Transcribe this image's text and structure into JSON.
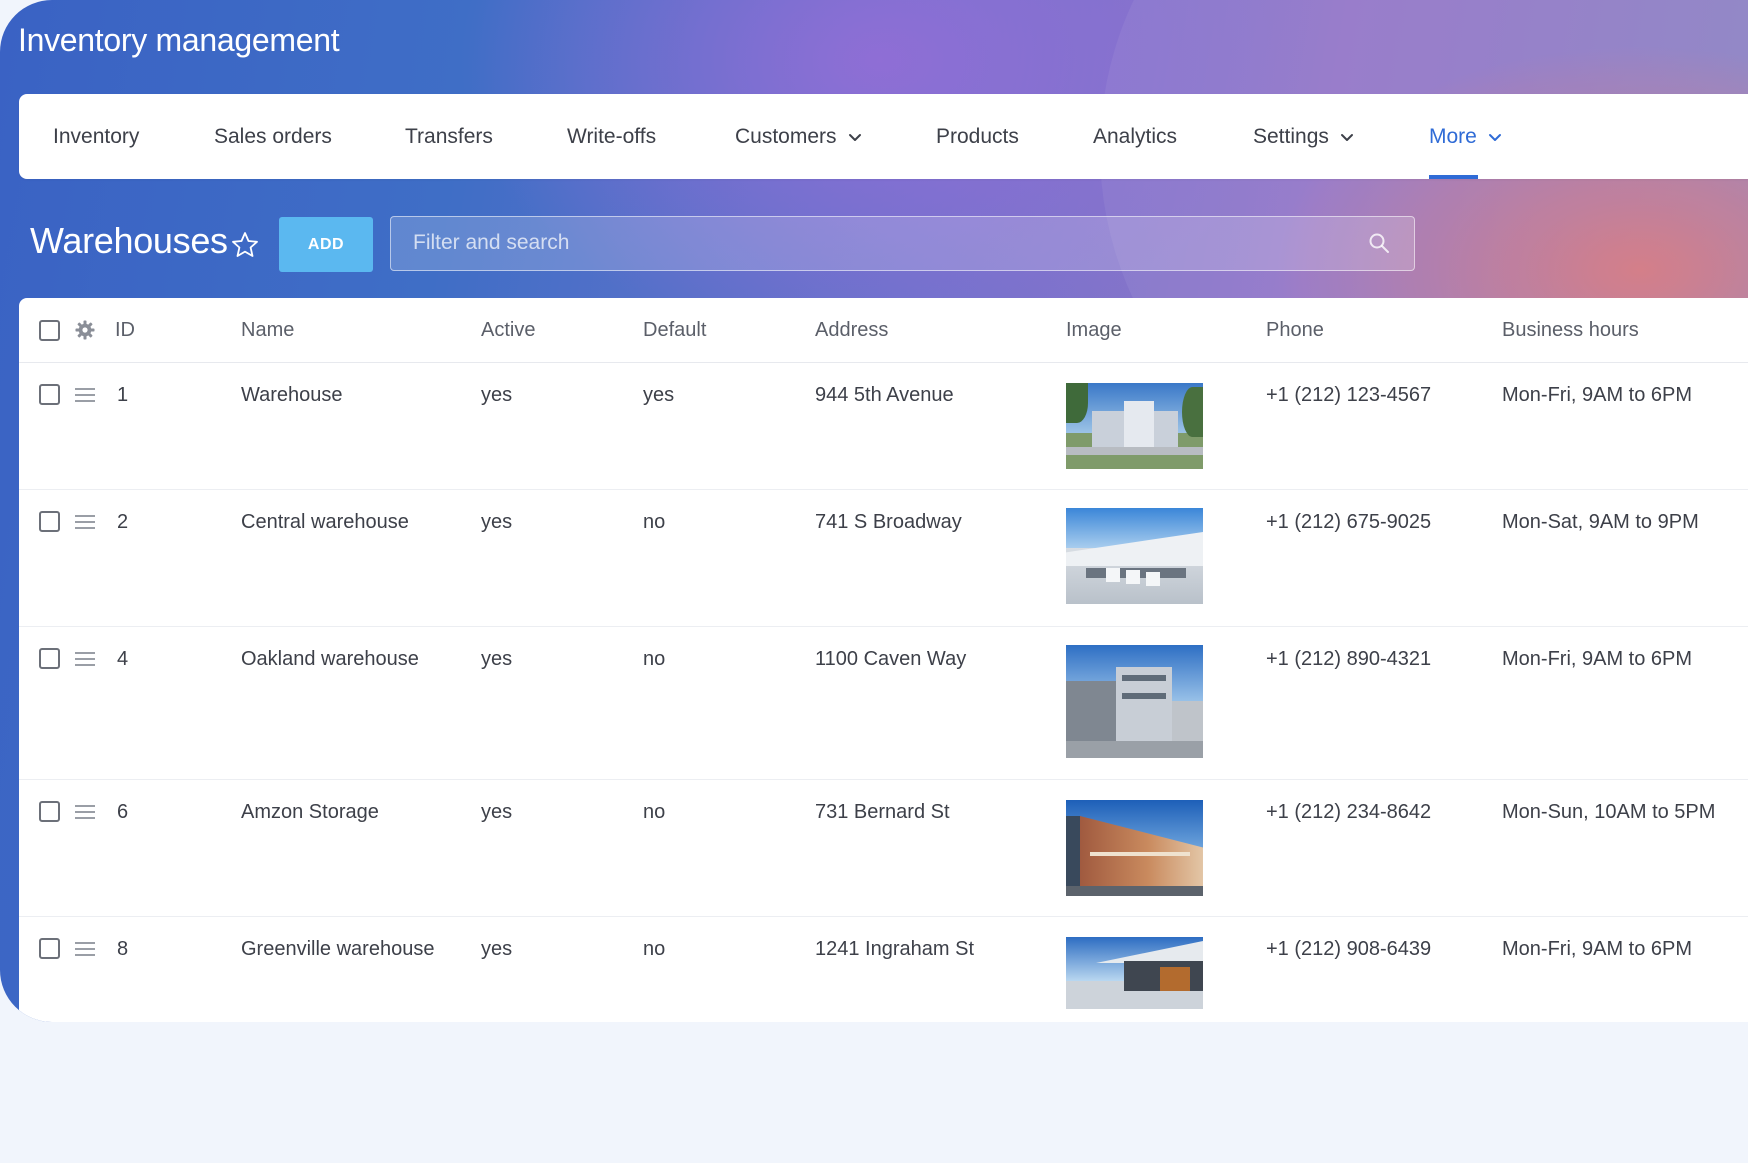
{
  "app": {
    "title": "Inventory management"
  },
  "nav": {
    "items": [
      {
        "label": "Inventory"
      },
      {
        "label": "Sales orders"
      },
      {
        "label": "Transfers"
      },
      {
        "label": "Write-offs"
      },
      {
        "label": "Customers"
      },
      {
        "label": "Products"
      },
      {
        "label": "Analytics"
      },
      {
        "label": "Settings"
      },
      {
        "label": "More"
      }
    ],
    "active": "More",
    "icons": {
      "dropdown": "chevron-down-icon"
    }
  },
  "page": {
    "title": "Warehouses",
    "add_label": "ADD",
    "search_placeholder": "Filter and search",
    "icons": {
      "favorite": "star-icon",
      "search": "search-icon"
    }
  },
  "table": {
    "columns": [
      "ID",
      "Name",
      "Active",
      "Default",
      "Address",
      "Image",
      "Phone",
      "Business hours"
    ],
    "icons": {
      "column_settings": "gear-icon",
      "row_drag": "drag-handle-icon"
    },
    "rows": [
      {
        "id": "1",
        "name": "Warehouse",
        "active": "yes",
        "default": "yes",
        "address": "944 5th Avenue",
        "phone": "+1 (212) 123-4567",
        "hours": "Mon-Fri, 9AM to 6PM"
      },
      {
        "id": "2",
        "name": "Central warehouse",
        "active": "yes",
        "default": "no",
        "address": "741 S Broadway",
        "phone": "+1 (212) 675-9025",
        "hours": "Mon-Sat, 9AM to 9PM"
      },
      {
        "id": "4",
        "name": "Oakland warehouse",
        "active": "yes",
        "default": "no",
        "address": "1100 Caven Way",
        "phone": "+1 (212) 890-4321",
        "hours": "Mon-Fri, 9AM to 6PM"
      },
      {
        "id": "6",
        "name": "Amzon Storage",
        "active": "yes",
        "default": "no",
        "address": "731 Bernard St",
        "phone": "+1 (212) 234-8642",
        "hours": "Mon-Sun, 10AM to 5PM"
      },
      {
        "id": "8",
        "name": "Greenville warehouse",
        "active": "yes",
        "default": "no",
        "address": "1241 Ingraham St",
        "phone": "+1 (212) 908-6439",
        "hours": "Mon-Fri, 9AM to 6PM"
      }
    ]
  },
  "colors": {
    "accent": "#2f6bd6",
    "add_button": "#5bb8f0",
    "text": "#3d4049",
    "header_text": "#5b5f69",
    "page_background": "#f1f5fc"
  }
}
